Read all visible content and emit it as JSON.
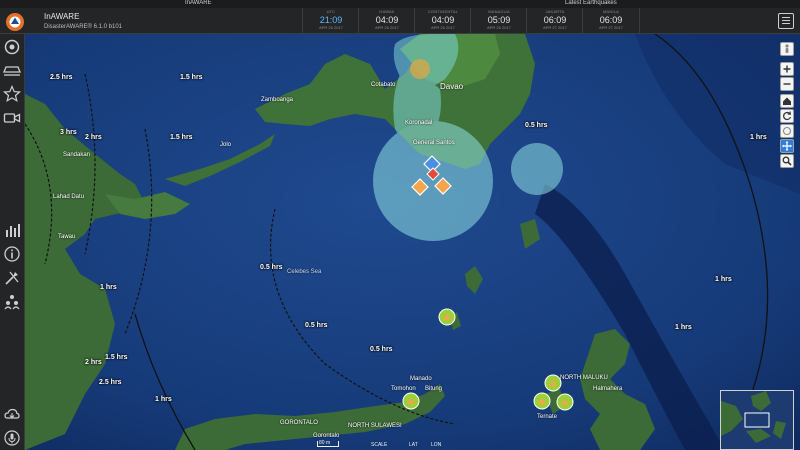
{
  "window": {
    "title_left": "InAWARE",
    "title_right": "Latest Earthquakes"
  },
  "app": {
    "name": "InAWARE",
    "version": "DisasterAWARE® 6.1.0 b101"
  },
  "clocks": [
    {
      "label": "UTC",
      "time": "21:09",
      "date": "APR 26 2017",
      "active": true
    },
    {
      "label": "HAWAII",
      "time": "04:09",
      "date": "APR 26 2017",
      "active": false
    },
    {
      "label": "CONTINENTAL",
      "time": "04:09",
      "date": "APR 26 2017",
      "active": false
    },
    {
      "label": "MANAGUA",
      "time": "05:09",
      "date": "APR 26 2017",
      "active": false
    },
    {
      "label": "JAKARTA",
      "time": "06:09",
      "date": "APR 27 2017",
      "active": false
    },
    {
      "label": "MANILA",
      "time": "06:09",
      "date": "APR 27 2017",
      "active": false
    }
  ],
  "places": [
    {
      "name": "Zamboanga"
    },
    {
      "name": "Cotabato"
    },
    {
      "name": "Davao"
    },
    {
      "name": "Koronadal"
    },
    {
      "name": "General Santos"
    },
    {
      "name": "Sandakan"
    },
    {
      "name": "Lahad Datu"
    },
    {
      "name": "Tawau"
    },
    {
      "name": "Jolo"
    },
    {
      "name": "Celebes Sea"
    },
    {
      "name": "Manado"
    },
    {
      "name": "Tomohon"
    },
    {
      "name": "Bitung"
    },
    {
      "name": "Ternate"
    },
    {
      "name": "NORTH MALUKU"
    },
    {
      "name": "Halmahera"
    },
    {
      "name": "GORONTALO"
    },
    {
      "name": "Gorontalo"
    },
    {
      "name": "NORTH SULAWESI"
    }
  ],
  "isochrones": [
    {
      "text": "0.5 hrs"
    },
    {
      "text": "1 hrs"
    },
    {
      "text": "1.5 hrs"
    },
    {
      "text": "2 hrs"
    },
    {
      "text": "2.5 hrs"
    },
    {
      "text": "3 hrs"
    }
  ],
  "scale": {
    "label": "SCALE",
    "distance": "80 m",
    "lat": "LAT",
    "lon": "LON"
  },
  "colors": {
    "ocean": "#173a78",
    "deep_ocean": "#0c2152",
    "land": "#3c6b37",
    "hazard": "#7ed3d6",
    "marker_orange": "#f4a44a",
    "marker_green": "#9bd03a"
  }
}
